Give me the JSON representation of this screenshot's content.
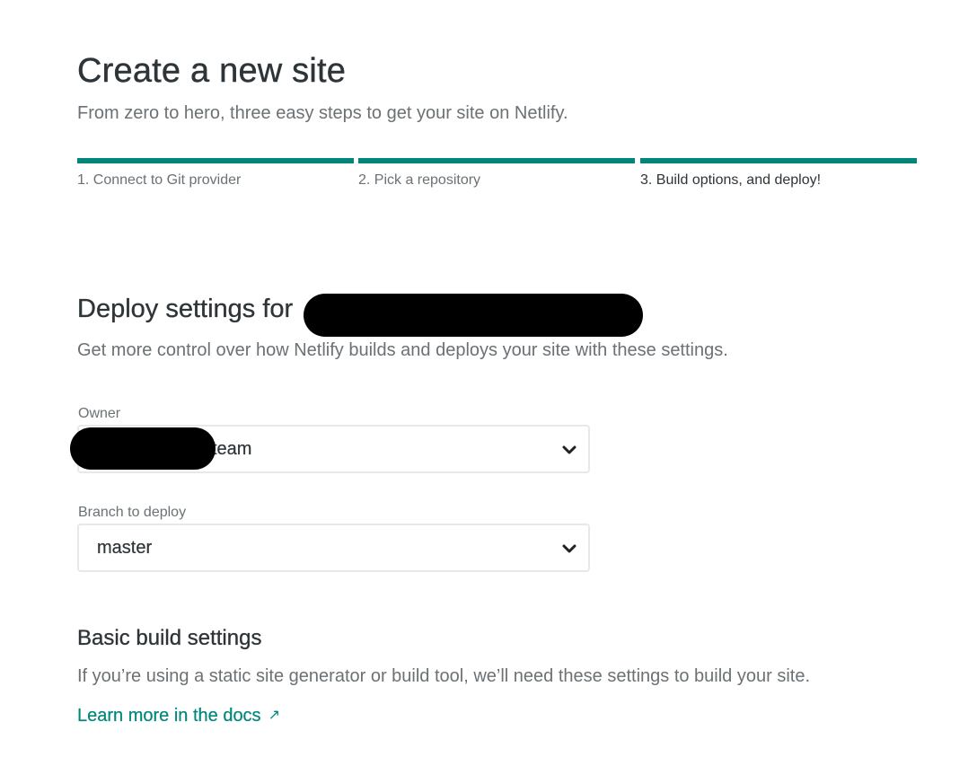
{
  "header": {
    "title": "Create a new site",
    "subtitle": "From zero to hero, three easy steps to get your site on Netlify."
  },
  "steps": [
    {
      "label": "1. Connect to Git provider",
      "state": "complete"
    },
    {
      "label": "2. Pick a repository",
      "state": "complete"
    },
    {
      "label": "3. Build options, and deploy!",
      "state": "current"
    }
  ],
  "deploy_settings": {
    "title": "Deploy settings for",
    "description": "Get more control over how Netlify builds and deploys your site with these settings.",
    "owner": {
      "label": "Owner",
      "value": "team"
    },
    "branch": {
      "label": "Branch to deploy",
      "value": "master"
    }
  },
  "basic_build": {
    "title": "Basic build settings",
    "description": "If you’re using a static site generator or build tool, we’ll need these settings to build your site.",
    "docs_link": {
      "label": "Learn more in the docs",
      "icon": "↗"
    }
  },
  "icons": {
    "select_chevron": "chevron-down-icon",
    "docs_link": "external-link-icon"
  },
  "colors": {
    "accent": "#00877a",
    "heading": "#2e3538",
    "muted": "#6b7174",
    "border": "#e6e8e9"
  }
}
